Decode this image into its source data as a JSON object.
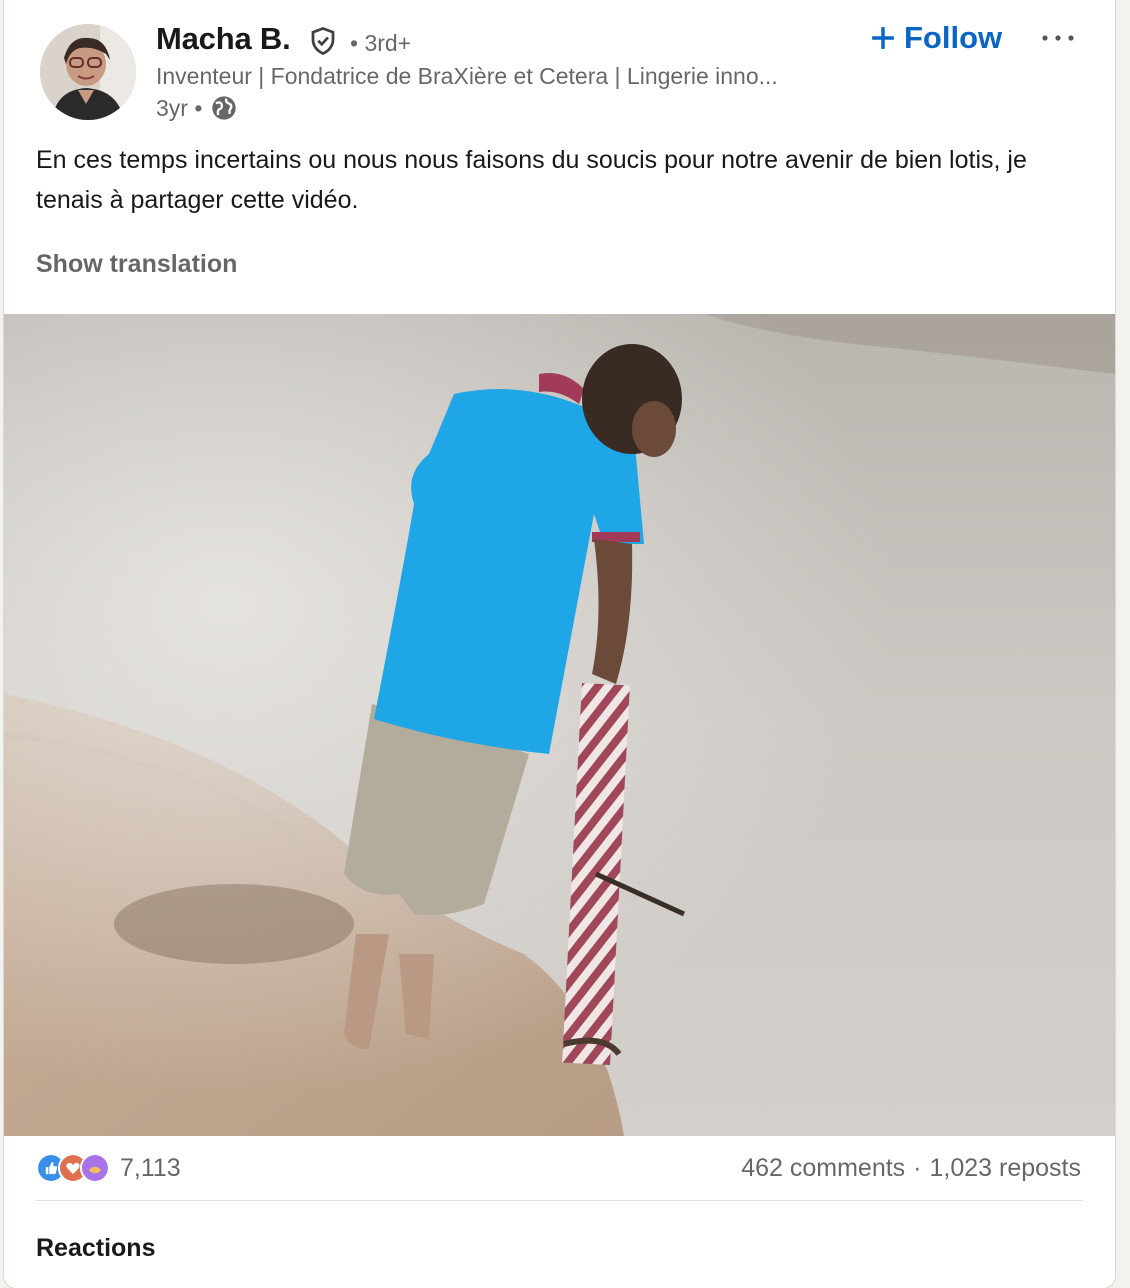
{
  "author": {
    "name": "Macha B.",
    "degree": "• 3rd+",
    "headline": "Inventeur | Fondatrice de BraXière et Cetera | Lingerie inno...",
    "time": "3yr •"
  },
  "actions": {
    "follow_label": "Follow",
    "more_icon": "ellipsis-icon"
  },
  "post": {
    "text": "En ces temps incertains ou nous nous faisons du soucis pour notre avenir de bien lotis, je tenais à partager cette vidéo.",
    "show_translation": "Show translation"
  },
  "social": {
    "reactions_count": "7,113",
    "comments": "462 comments",
    "separator": "·",
    "reposts": "1,023 reposts",
    "reaction_types": [
      "like",
      "love",
      "insightful"
    ]
  },
  "below": {
    "cut_text": "Reactions"
  },
  "colors": {
    "accent": "#0a66c2",
    "shirt": "#1fa6e6"
  }
}
